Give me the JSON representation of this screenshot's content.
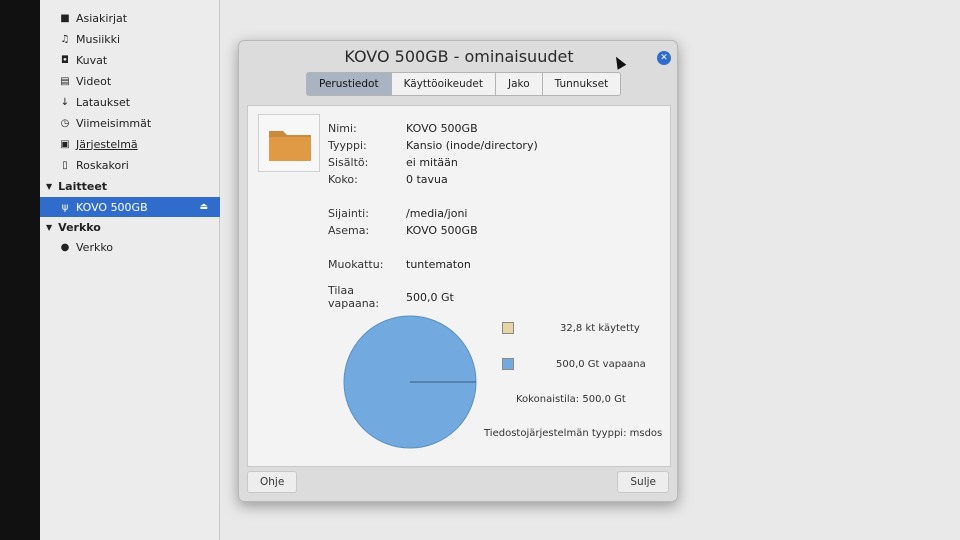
{
  "sidebar": {
    "items": [
      {
        "label": "Asiakirjat",
        "icon": "document-icon"
      },
      {
        "label": "Musiikki",
        "icon": "music-icon"
      },
      {
        "label": "Kuvat",
        "icon": "camera-icon"
      },
      {
        "label": "Videot",
        "icon": "film-icon"
      },
      {
        "label": "Lataukset",
        "icon": "download-icon"
      },
      {
        "label": "Viimeisimmät",
        "icon": "clock-icon"
      },
      {
        "label": "Järjestelmä",
        "icon": "drive-icon"
      },
      {
        "label": "Roskakori",
        "icon": "trash-icon"
      }
    ],
    "devices_header": "Laitteet",
    "device": {
      "label": "KOVO 500GB",
      "icon": "usb-icon"
    },
    "network_header": "Verkko",
    "network_item": {
      "label": "Verkko",
      "icon": "globe-icon"
    }
  },
  "dialog": {
    "title": "KOVO 500GB - ominaisuudet",
    "tabs": [
      "Perustiedot",
      "Käyttöoikeudet",
      "Jako",
      "Tunnukset"
    ],
    "active_tab": "Perustiedot",
    "fields": {
      "name_label": "Nimi:",
      "name_value": "KOVO 500GB",
      "type_label": "Tyyppi:",
      "type_value": "Kansio (inode/directory)",
      "contents_label": "Sisältö:",
      "contents_value": "ei mitään",
      "size_label": "Koko:",
      "size_value": "0 tavua",
      "location_label": "Sijainti:",
      "location_value": "/media/joni",
      "volume_label": "Asema:",
      "volume_value": "KOVO 500GB",
      "modified_label": "Muokattu:",
      "modified_value": "tuntematon",
      "free_label": "Tilaa vapaana:",
      "free_value": "500,0 Gt"
    },
    "usage": {
      "used_label": "32,8 kt käytetty",
      "free_label": "500,0 Gt vapaana",
      "total_label": "Kokonaistila: 500,0 Gt",
      "fs_label": "Tiedostojärjestelmän tyyppi: msdos",
      "used_fraction": 6.56e-08,
      "used_color": "#e8d3a4",
      "free_color": "#72a9de"
    },
    "help_button": "Ohje",
    "close_button": "Sulje"
  }
}
